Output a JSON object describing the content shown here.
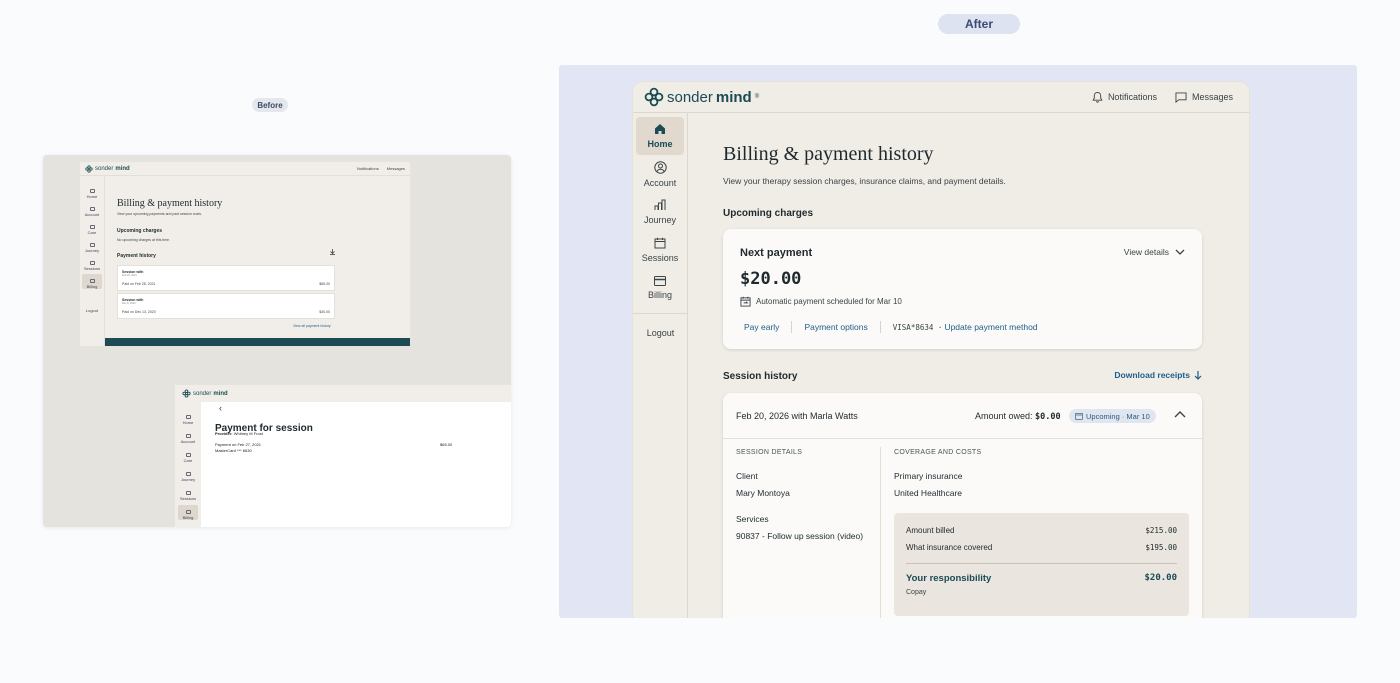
{
  "labels": {
    "before": "Before",
    "after": "After"
  },
  "before": {
    "app": {
      "brand_plain": "sonder",
      "brand_bold": "mind",
      "notifications": "Notifications",
      "messages": "Messages",
      "nav": [
        "Home",
        "Account",
        "Care",
        "Journey",
        "Sessions",
        "Billing"
      ],
      "logout": "Logout",
      "title": "Billing & payment history",
      "subtitle": "View your upcoming payments and past session costs.",
      "upcoming_heading": "Upcoming charges",
      "upcoming_text": "No upcoming charges at this time.",
      "history_heading": "Payment history",
      "history": [
        {
          "title": "Session with",
          "date": "Feb 23, 2021",
          "paid": "Paid on Feb 28, 2021",
          "amount": "$65.00"
        },
        {
          "title": "Session with",
          "date": "Dec 8, 2020",
          "paid": "Paid on Dec 13, 2020",
          "amount": "$40.00"
        }
      ],
      "view_all": "View all payment history"
    },
    "detail": {
      "brand_plain": "sonder",
      "brand_bold": "mind",
      "nav": [
        "Home",
        "Account",
        "Care",
        "Journey",
        "Sessions",
        "Billing"
      ],
      "back": "‹",
      "title": "Payment for session",
      "provider_label": "Provider:",
      "provider": "Whitney M Frost",
      "payment_line": "Payment on Feb 27, 2021",
      "card_line": "MasterCard *** 8630",
      "amount": "$65.00"
    }
  },
  "after": {
    "brand_plain": "sonder",
    "brand_bold": "mind",
    "brand_mark": "®",
    "top_nav": {
      "notifications": "Notifications",
      "messages": "Messages"
    },
    "nav": [
      {
        "label": "Home",
        "icon": "home-icon"
      },
      {
        "label": "Account",
        "icon": "account-icon"
      },
      {
        "label": "Journey",
        "icon": "journey-icon"
      },
      {
        "label": "Sessions",
        "icon": "calendar-icon"
      },
      {
        "label": "Billing",
        "icon": "card-icon"
      }
    ],
    "logout": "Logout",
    "title": "Billing & payment history",
    "subtitle": "View your therapy session charges, insurance claims, and payment details.",
    "upcoming": {
      "heading": "Upcoming charges",
      "card_title": "Next payment",
      "view_details": "View details",
      "amount": "$20.00",
      "auto_text": "Automatic payment scheduled for Mar 10",
      "links": {
        "pay_early": "Pay early",
        "payment_options": "Payment options",
        "visa": "VISA*8634 · ",
        "update": "Update payment method"
      }
    },
    "history": {
      "heading": "Session history",
      "download": "Download receipts",
      "session": {
        "date": "Feb 20, 2026 with Marla Watts",
        "owed_label": "Amount owed: ",
        "owed_value": "$0.00",
        "badge": "Upcoming · Mar 10",
        "details_cap": "SESSION DETAILS",
        "client_label": "Client",
        "client": "Mary Montoya",
        "services_label": "Services",
        "service": "90837 - Follow up session (video)",
        "coverage_cap": "COVERAGE AND COSTS",
        "insurance_label": "Primary insurance",
        "insurance": "United Healthcare",
        "billed_label": "Amount billed",
        "billed": "$215.00",
        "covered_label": "What insurance covered",
        "covered": "$195.00",
        "resp_label": "Your responsibility",
        "resp": "$20.00",
        "copay": "Copay"
      }
    }
  },
  "colors": {
    "brand": "#1b4b55",
    "link": "#1f5e8c",
    "accent_bg": "#e2e5f4"
  }
}
